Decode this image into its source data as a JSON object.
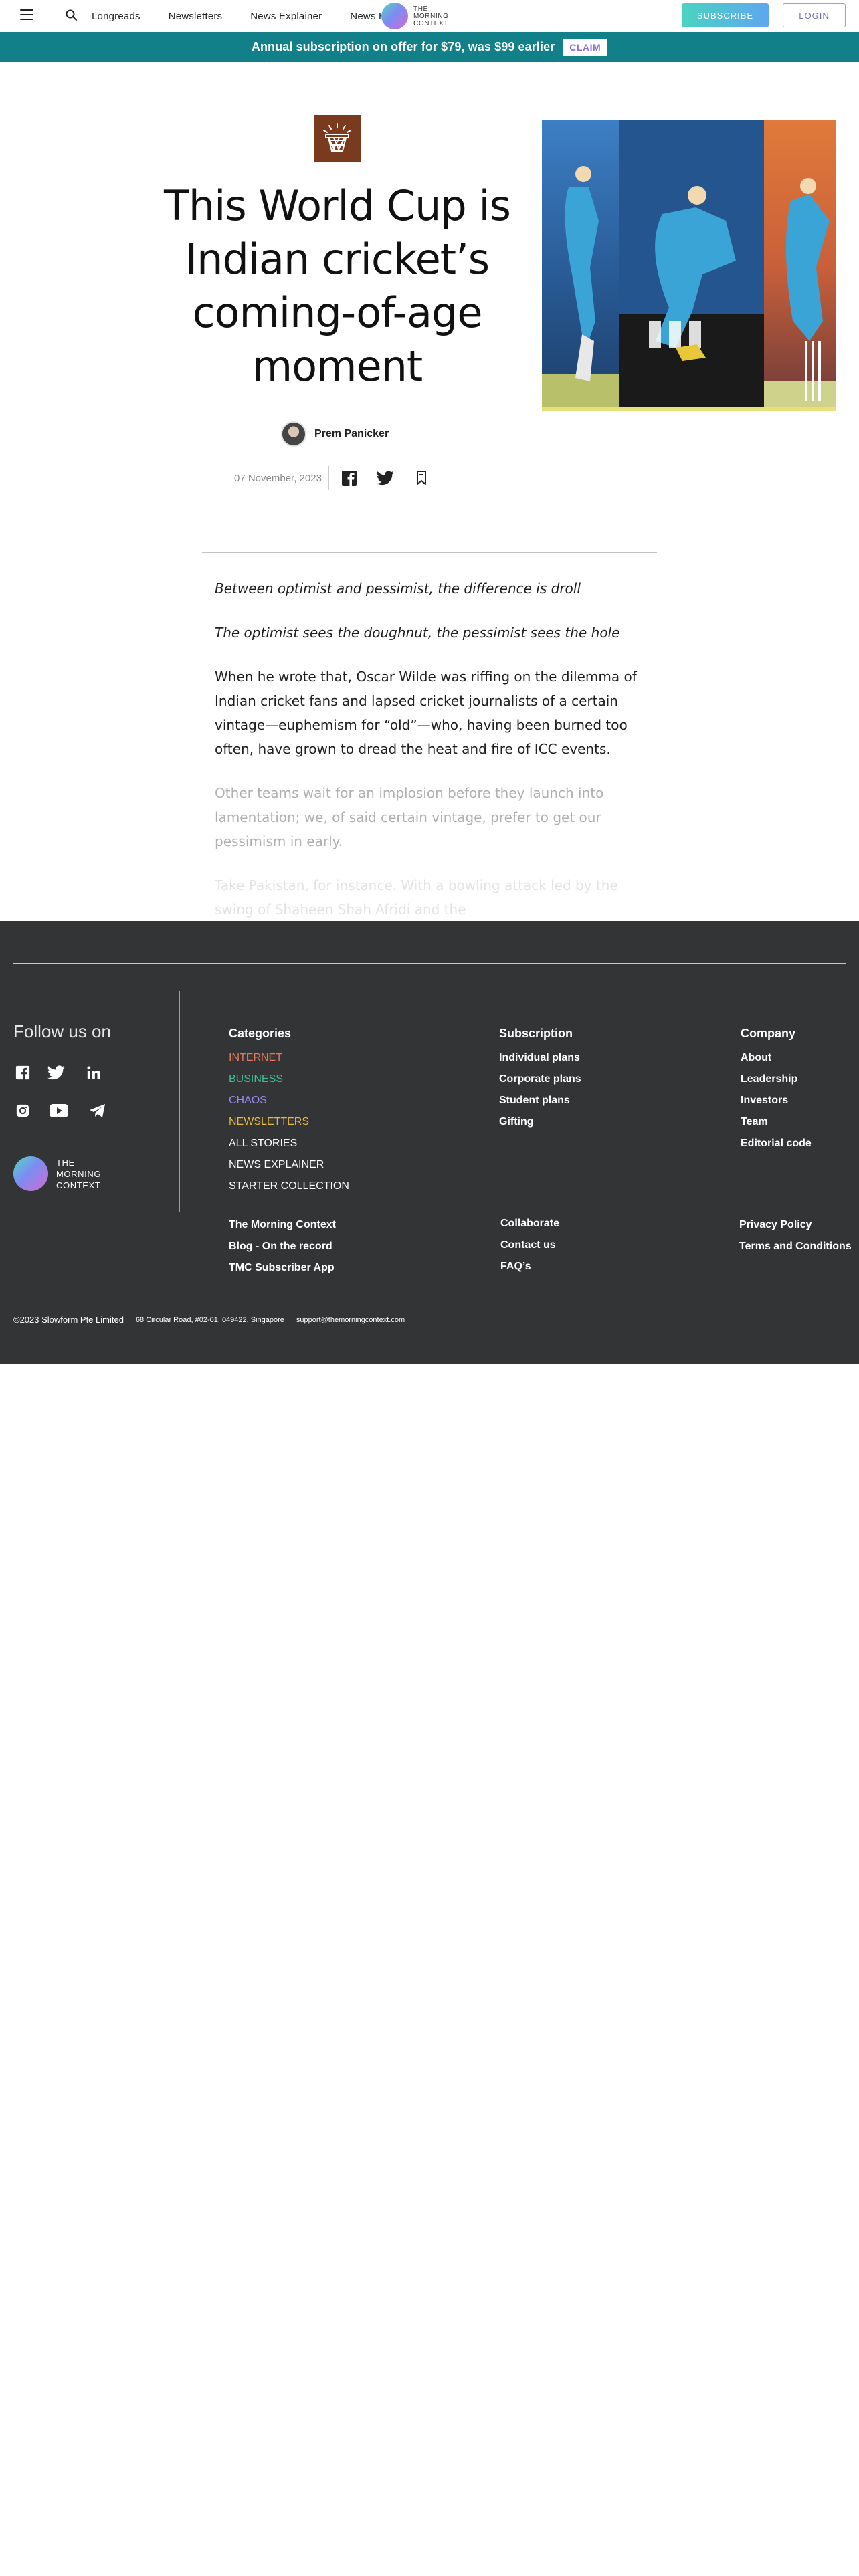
{
  "header": {
    "nav": [
      "Longreads",
      "Newsletters",
      "News Explainer",
      "News E"
    ],
    "logo_lines": [
      "THE",
      "MORNING",
      "CONTEXT"
    ],
    "subscribe_label": "SUBSCRIBE",
    "login_label": "LOGIN"
  },
  "promo": {
    "text": "Annual subscription on offer for $79, was $99 earlier",
    "claim_label": "CLAIM"
  },
  "article": {
    "headline": "This World Cup is Indian cricket’s coming-of-age moment",
    "author": "Prem Panicker",
    "date": "07 November, 2023",
    "section_icon": "basketball-hoop-icon",
    "paragraphs": [
      "Between optimist and pessimist, the difference is droll",
      "The optimist sees the doughnut, the pessimist sees the hole",
      "When he wrote that, Oscar Wilde was riffing on the dilemma of Indian cricket fans and lapsed cricket journalists of a certain vintage—euphemism for “old”—who, having been burned too often, have grown to dread the heat and fire of ICC events.",
      "Other teams wait for an implosion before they launch into lamentation; we, of said certain vintage, prefer to get our pessimism in early.",
      "Take Pakistan, for instance. With a bowling attack led by the swing of Shaheen Shah Afridi and the"
    ]
  },
  "footer": {
    "follow_label": "Follow us on",
    "social": [
      "facebook-icon",
      "twitter-icon",
      "linkedin-icon",
      "instagram-icon",
      "youtube-icon",
      "telegram-icon"
    ],
    "logo_lines": [
      "THE",
      "MORNING",
      "CONTEXT"
    ],
    "categories": {
      "heading": "Categories",
      "items": [
        {
          "label": "INTERNET",
          "color": "#e8775a"
        },
        {
          "label": "BUSINESS",
          "color": "#3fbf8f"
        },
        {
          "label": "CHAOS",
          "color": "#9a8cf0"
        },
        {
          "label": "NEWSLETTERS",
          "color": "#e8b840"
        },
        {
          "label": "ALL STORIES",
          "color": "#ffffff"
        },
        {
          "label": "NEWS EXPLAINER",
          "color": "#ffffff"
        },
        {
          "label": "STARTER COLLECTION",
          "color": "#ffffff"
        }
      ],
      "extra": [
        "The Morning Context",
        "Blog - On the record",
        "TMC Subscriber App"
      ]
    },
    "subscription": {
      "heading": "Subscription",
      "items": [
        "Individual plans",
        "Corporate plans",
        "Student plans",
        "Gifting"
      ],
      "extra": [
        "Collaborate",
        "Contact us",
        "FAQ’s"
      ]
    },
    "company": {
      "heading": "Company",
      "items": [
        "About",
        "Leadership",
        "Investors",
        "Team",
        "Editorial code"
      ],
      "extra": [
        "Privacy Policy",
        "Terms and Conditions"
      ]
    },
    "copyright": "©2023 Slowform Pte Limited",
    "address": "68 Circular Road, #02-01, 049422, Singapore",
    "email": "support@themorningcontext.com"
  }
}
